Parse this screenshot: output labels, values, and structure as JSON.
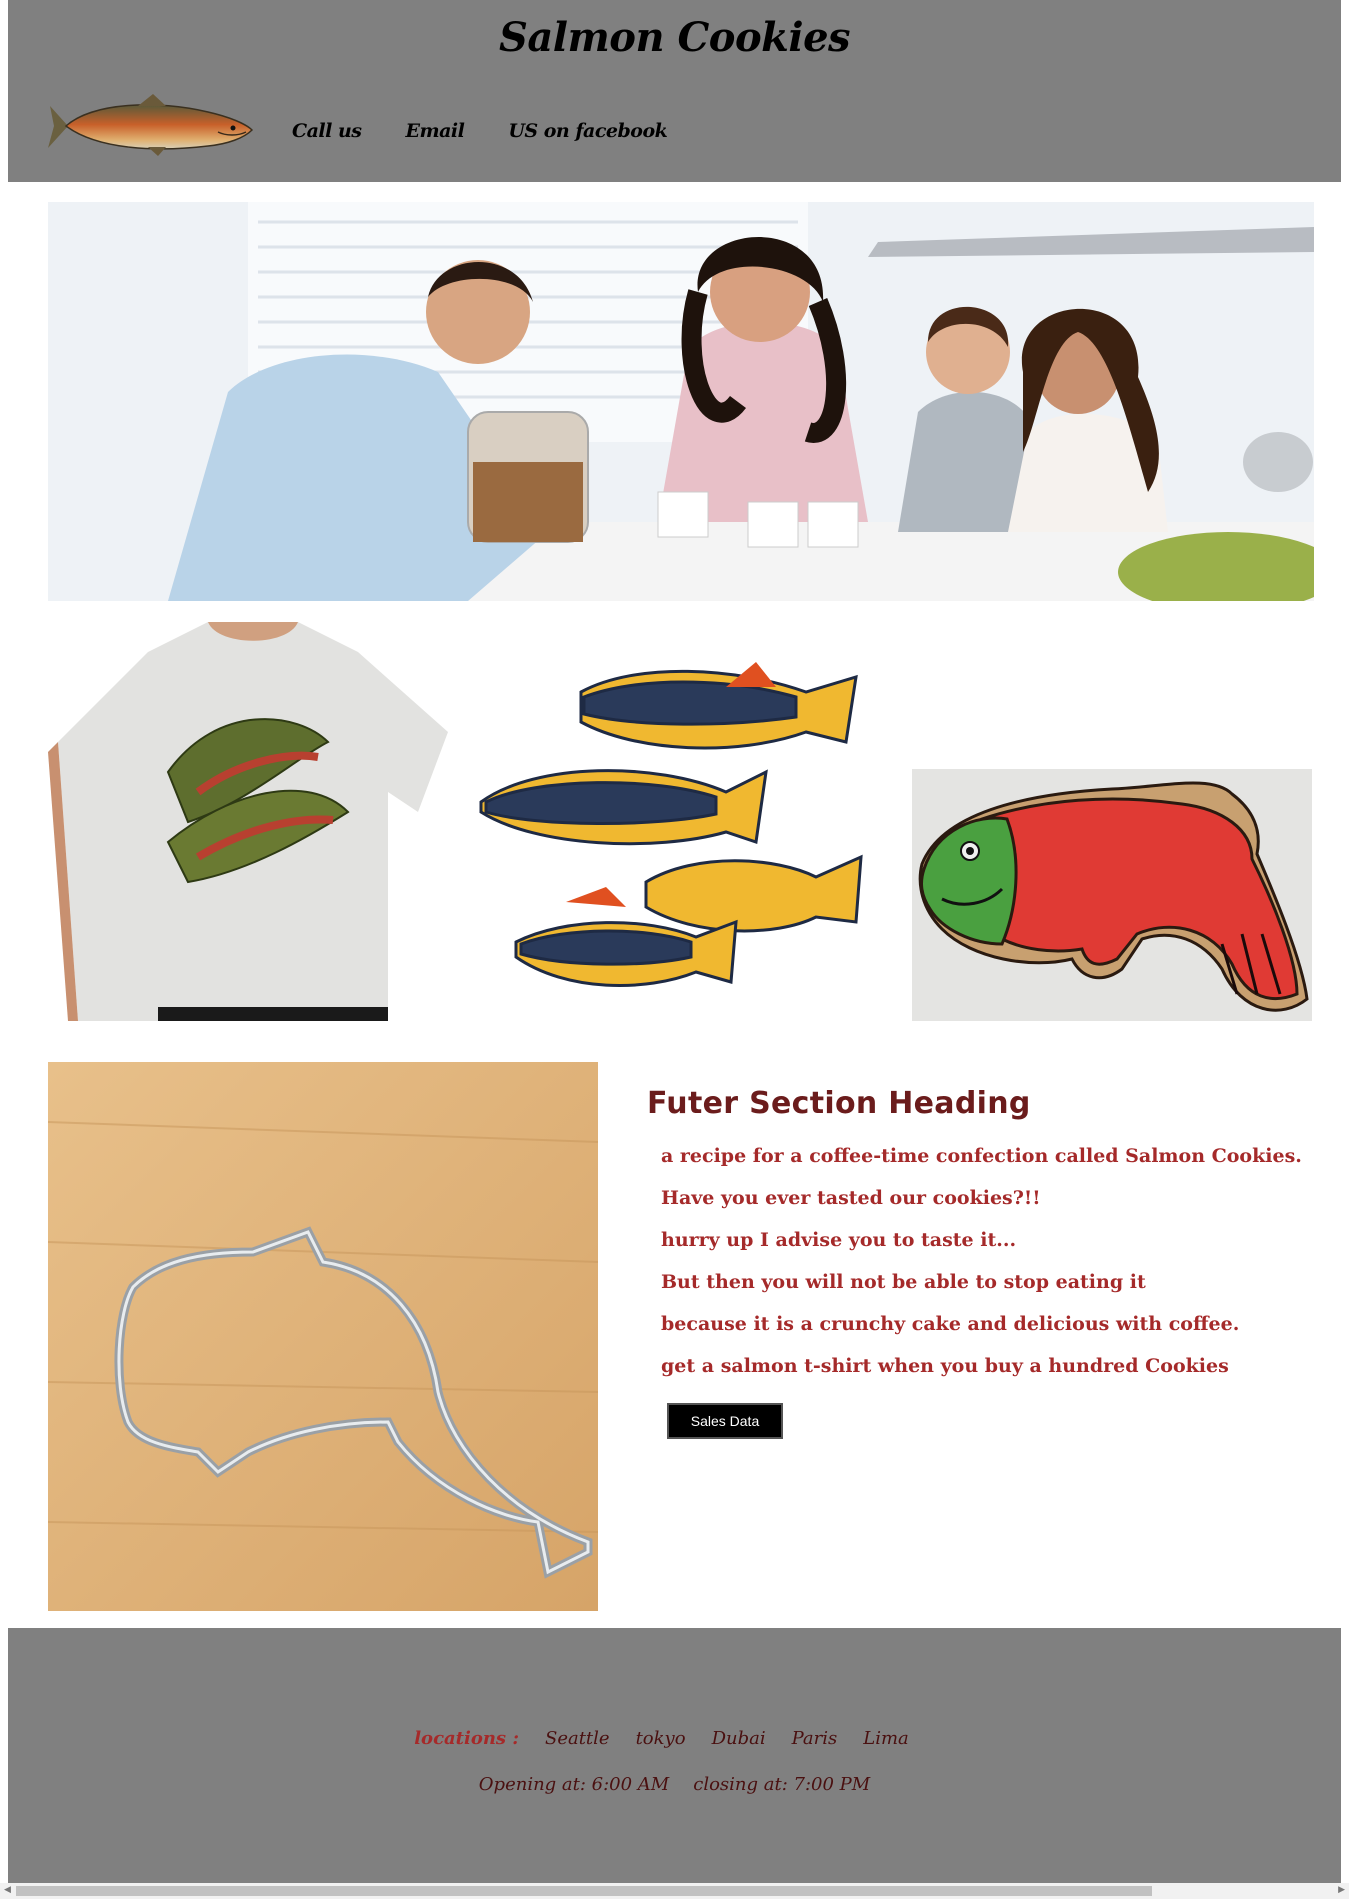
{
  "header": {
    "title": "Salmon Cookies",
    "nav": [
      "Call us",
      "Email",
      "US on facebook"
    ]
  },
  "section": {
    "heading": "Futer Section Heading",
    "lines": [
      "a recipe for a coffee-time confection called Salmon Cookies.",
      "Have you ever tasted our cookies?!!",
      "hurry up I advise you to taste it...",
      "But then you will not be able to stop eating it",
      "because it is a crunchy cake and delicious with coffee.",
      "get a salmon t-shirt when you buy a hundred Cookies"
    ],
    "button_label": "Sales Data"
  },
  "footer": {
    "locations_label": "locations :",
    "cities": [
      "Seattle",
      "tokyo",
      "Dubai",
      "Paris",
      "Lima"
    ],
    "opening": "Opening at: 6:00 AM",
    "closing": "closing at: 7:00 PM"
  },
  "colors": {
    "header_bg": "#808080",
    "heading": "#6b1c1c",
    "body_text": "#a52a2a",
    "button_bg": "#000000"
  },
  "icons": [
    "salmon-logo-icon",
    "scroll-left-arrow-icon",
    "scroll-right-arrow-icon"
  ]
}
